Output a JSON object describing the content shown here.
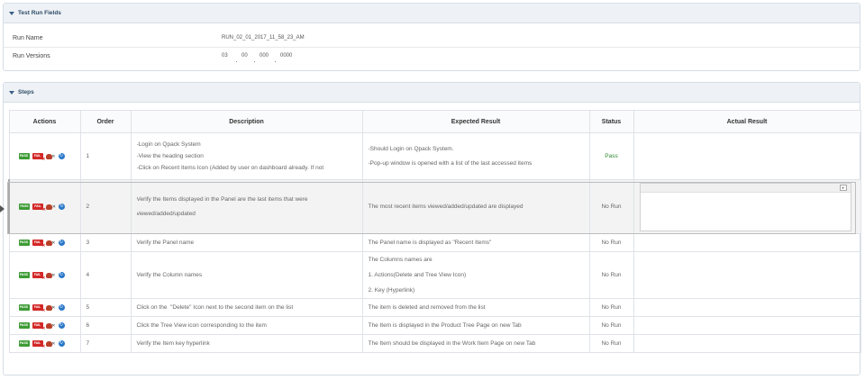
{
  "test_run_fields": {
    "title": "Test Run Fields",
    "run_name_label": "Run Name",
    "run_name_value": "RUN_02_01_2017_11_58_23_AM",
    "run_versions_label": "Run Versions",
    "run_versions": [
      "03",
      "00",
      "000",
      "0000"
    ]
  },
  "steps": {
    "title": "Steps",
    "columns": {
      "actions": "Actions",
      "order": "Order",
      "description": "Description",
      "expected": "Expected Result",
      "status": "Status",
      "actual": "Actual Result"
    },
    "action_icons": {
      "pass": "PASS",
      "fail": "FAIL"
    },
    "rows": [
      {
        "order": "1",
        "description": [
          "-Login on Qpack System",
          "-View the heading section",
          "-Click on Recent Items Icon (Added by user on dashboard already. If not"
        ],
        "expected": [
          "-Should Login on Qpack System.",
          "-Pop-up window is opened with a list of the last accessed items"
        ],
        "status": "Pass"
      },
      {
        "order": "2",
        "description": [
          "Verify the Items displayed in the Panel are the last items that were",
          "viewed/added/updated"
        ],
        "expected": [
          "The most recent items viewed/added/updated are displayed"
        ],
        "status": "No Run"
      },
      {
        "order": "3",
        "description": [
          "Verify the Panel name"
        ],
        "expected": [
          "The Panel name is displayed as \"Recent Items\""
        ],
        "status": "No Run"
      },
      {
        "order": "4",
        "description": [
          "Verify the Column names"
        ],
        "expected": [
          "The Columns names are",
          "1. Actions(Delete and Tree View Icon)",
          "2. Key (Hyperlink)"
        ],
        "status": "No Run"
      },
      {
        "order": "5",
        "description": [
          "Click on the  \"Delete\" Icon next to the second item on the list"
        ],
        "expected": [
          "The item is deleted and removed from the list"
        ],
        "status": "No Run"
      },
      {
        "order": "6",
        "description": [
          "Click the Tree View icon corresponding to the item"
        ],
        "expected": [
          "The Item is displayed in the Product Tree Page on new Tab"
        ],
        "status": "No Run"
      },
      {
        "order": "7",
        "description": [
          "Verify the Item key hyperlink"
        ],
        "expected": [
          "The Item should be displayed in the Work Item Page on new Tab"
        ],
        "status": "No Run"
      }
    ]
  },
  "colors": {
    "pass_green": "#3d9b35",
    "fail_red": "#d32727",
    "header_bg": "#eef2f6",
    "title_blue": "#2e4a66"
  }
}
